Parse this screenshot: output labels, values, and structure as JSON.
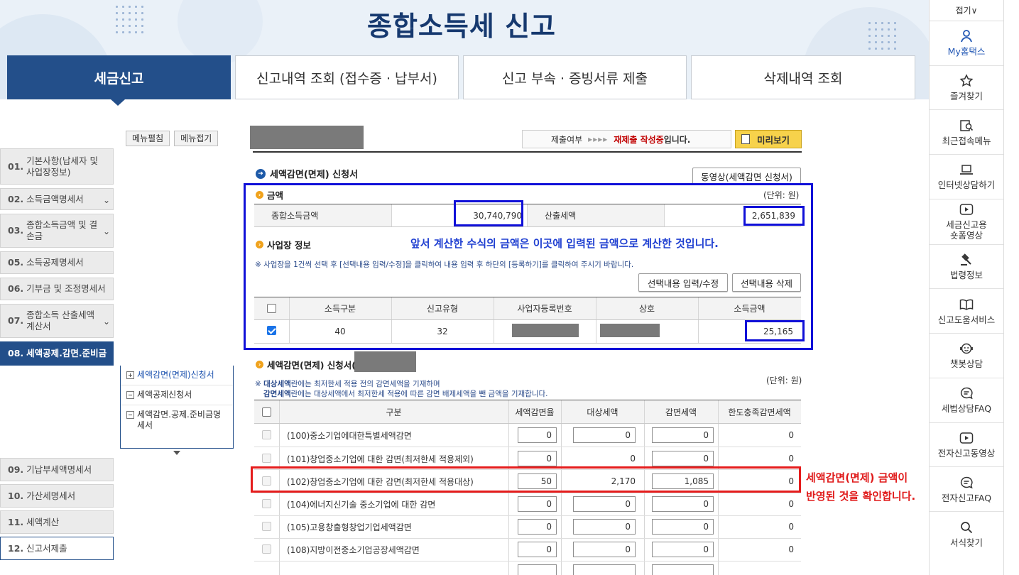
{
  "header": {
    "title": "종합소득세 신고",
    "tabs": [
      "세금신고",
      "신고내역 조회 (접수증 · 납부서)",
      "신고 부속 · 증빙서류 제출",
      "삭제내역 조회"
    ]
  },
  "quick_menu": {
    "fold": "접기∨",
    "items": [
      {
        "label": "My홈택스",
        "icon": "person-icon"
      },
      {
        "label": "즐겨찾기",
        "icon": "star-icon"
      },
      {
        "label": "최근접속메뉴",
        "icon": "recent-search-icon"
      },
      {
        "label": "인터넷상담하기",
        "icon": "laptop-icon"
      },
      {
        "label1": "세금신고용",
        "label2": "숏폼영상",
        "icon": "play-icon"
      },
      {
        "label": "법령정보",
        "icon": "gavel-icon"
      },
      {
        "label": "신고도움서비스",
        "icon": "book-icon"
      },
      {
        "label": "챗봇상담",
        "icon": "chatbot-icon"
      },
      {
        "label": "세법상담FAQ",
        "icon": "chat-icon"
      },
      {
        "label": "전자신고동영상",
        "icon": "play-icon"
      },
      {
        "label": "전자신고FAQ",
        "icon": "chat-icon"
      },
      {
        "label": "서식찾기",
        "icon": "search-icon"
      }
    ]
  },
  "sidebar": {
    "expand_all": "메뉴펼침",
    "collapse_all": "메뉴접기",
    "items": [
      {
        "num": "01.",
        "label": "기본사항(납세자 및 사업장정보)"
      },
      {
        "num": "02.",
        "label": "소득금액명세서"
      },
      {
        "num": "03.",
        "label": "종합소득금액 및 결손금"
      },
      {
        "num": "05.",
        "label": "소득공제명세서"
      },
      {
        "num": "06.",
        "label": "기부금 및 조정명세서"
      },
      {
        "num": "07.",
        "label": "종합소득 산출세액계산서"
      },
      {
        "num": "08.",
        "label": "세액공제.감면.준비금"
      },
      {
        "num": "09.",
        "label": "기납부세액명세서"
      },
      {
        "num": "10.",
        "label": "가산세명세서"
      },
      {
        "num": "11.",
        "label": "세액계산"
      },
      {
        "num": "12.",
        "label": "신고서제출"
      }
    ],
    "subitems": [
      "세액감면(면제)신청서",
      "세액공제신청서",
      "세액감면.공제.준비금명세서"
    ]
  },
  "status": {
    "label": "제출여부",
    "arrows": "▸▸▸▸",
    "value_red": "재제출 작성중",
    "value_suffix": "입니다.",
    "preview": "미리보기"
  },
  "form": {
    "title": "세액감면(면제) 신청서",
    "video_btn": "동영상(세액감면 신청서)",
    "amount_section": "금액",
    "unit": "(단위: 원)",
    "total_income_label": "종합소득금액",
    "total_income_value": "30,740,790",
    "calc_tax_label": "산출세액",
    "calc_tax_value": "2,651,839",
    "biz_section": "사업장 정보",
    "biz_note": "※ 사업장을 1건씩 선택 후 [선택내용 입력/수정]을 클릭하여 내용 입력 후 하단의 [등록하기]를 클릭하여 주시기 바랍니다.",
    "edit_btn": "선택내용 입력/수정",
    "delete_btn": "선택내용 삭제",
    "biz_headers": [
      "소득구분",
      "신고유형",
      "사업자등록번호",
      "상호",
      "소득금액"
    ],
    "biz_row": {
      "income_type": "40",
      "report_type": "32",
      "income": "25,165"
    },
    "annotation_blue": "앞서 계산한 수식의 금액은 이곳에 입력된 금액으로 계산한 것입니다.",
    "reduction_section": "세액감면(면제) 신청서(",
    "note1_pre": "※ ",
    "note1_bold": "대상세액",
    "note1_rest": "란에는 최저한세 적용 전의 감면세액을 기재하며",
    "note2_bold": "감면세액",
    "note2_rest": "란에는 대상세액에서 최저한세 적용에 따른 감면 배제세액을 뺀 금액을 기재합니다.",
    "reduction_headers": [
      "구분",
      "세액감면율",
      "대상세액",
      "감면세액",
      "한도충족감면세액"
    ],
    "rows": [
      {
        "name": "(100)중소기업에대한특별세액감면",
        "rate": "0",
        "target": "0",
        "reduce": "0",
        "limit": "0",
        "target_plain": false
      },
      {
        "name": "(101)창업중소기업에 대한 감면(최저한세 적용제외)",
        "rate": "0",
        "target": "0",
        "reduce": "0",
        "limit": "0",
        "target_plain": true
      },
      {
        "name": "(102)창업중소기업에 대한 감면(최저한세 적용대상)",
        "rate": "50",
        "target": "2,170",
        "reduce": "1,085",
        "limit": "0",
        "target_plain": true
      },
      {
        "name": "(104)에너지신기술 중소기업에 대한 감면",
        "rate": "0",
        "target": "0",
        "reduce": "0",
        "limit": "0",
        "target_plain": false
      },
      {
        "name": "(105)고용창출형창업기업세액감면",
        "rate": "0",
        "target": "0",
        "reduce": "0",
        "limit": "0",
        "target_plain": false
      },
      {
        "name": "(108)지방이전중소기업공장세액감면",
        "rate": "0",
        "target": "0",
        "reduce": "0",
        "limit": "0",
        "target_plain": false
      }
    ],
    "annotation_red1": "세액감면(면제) 금액이",
    "annotation_red2": "반영된 것을 확인합니다."
  }
}
